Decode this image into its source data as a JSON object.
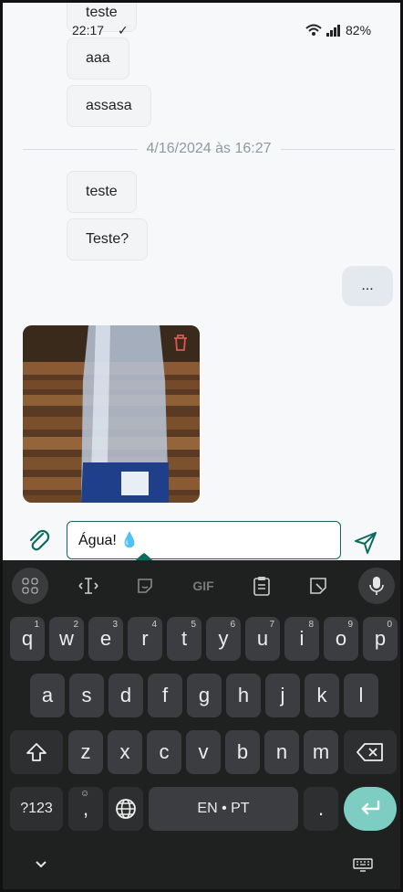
{
  "status_bar": {
    "time": "22:17",
    "battery": "82%"
  },
  "messages": {
    "m0": "teste",
    "m1": "aaa",
    "m2": "assasa",
    "divider": "4/16/2024 às 16:27",
    "m3": "teste",
    "m4": "Teste?",
    "mine": "..."
  },
  "composer": {
    "text": "Água! 💧"
  },
  "keyboard": {
    "row1": [
      {
        "k": "q",
        "h": "1"
      },
      {
        "k": "w",
        "h": "2"
      },
      {
        "k": "e",
        "h": "3"
      },
      {
        "k": "r",
        "h": "4"
      },
      {
        "k": "t",
        "h": "5"
      },
      {
        "k": "y",
        "h": "6"
      },
      {
        "k": "u",
        "h": "7"
      },
      {
        "k": "i",
        "h": "8"
      },
      {
        "k": "o",
        "h": "9"
      },
      {
        "k": "p",
        "h": "0"
      }
    ],
    "row2": [
      "a",
      "s",
      "d",
      "f",
      "g",
      "h",
      "j",
      "k",
      "l"
    ],
    "row3": [
      "z",
      "x",
      "c",
      "v",
      "b",
      "n",
      "m"
    ],
    "symbols": "?123",
    "comma": ",",
    "space": "EN • PT",
    "period": ".",
    "gif": "GIF"
  },
  "colors": {
    "accent": "#0c6a60",
    "enter": "#7ecdc3",
    "trash": "#e25555"
  }
}
